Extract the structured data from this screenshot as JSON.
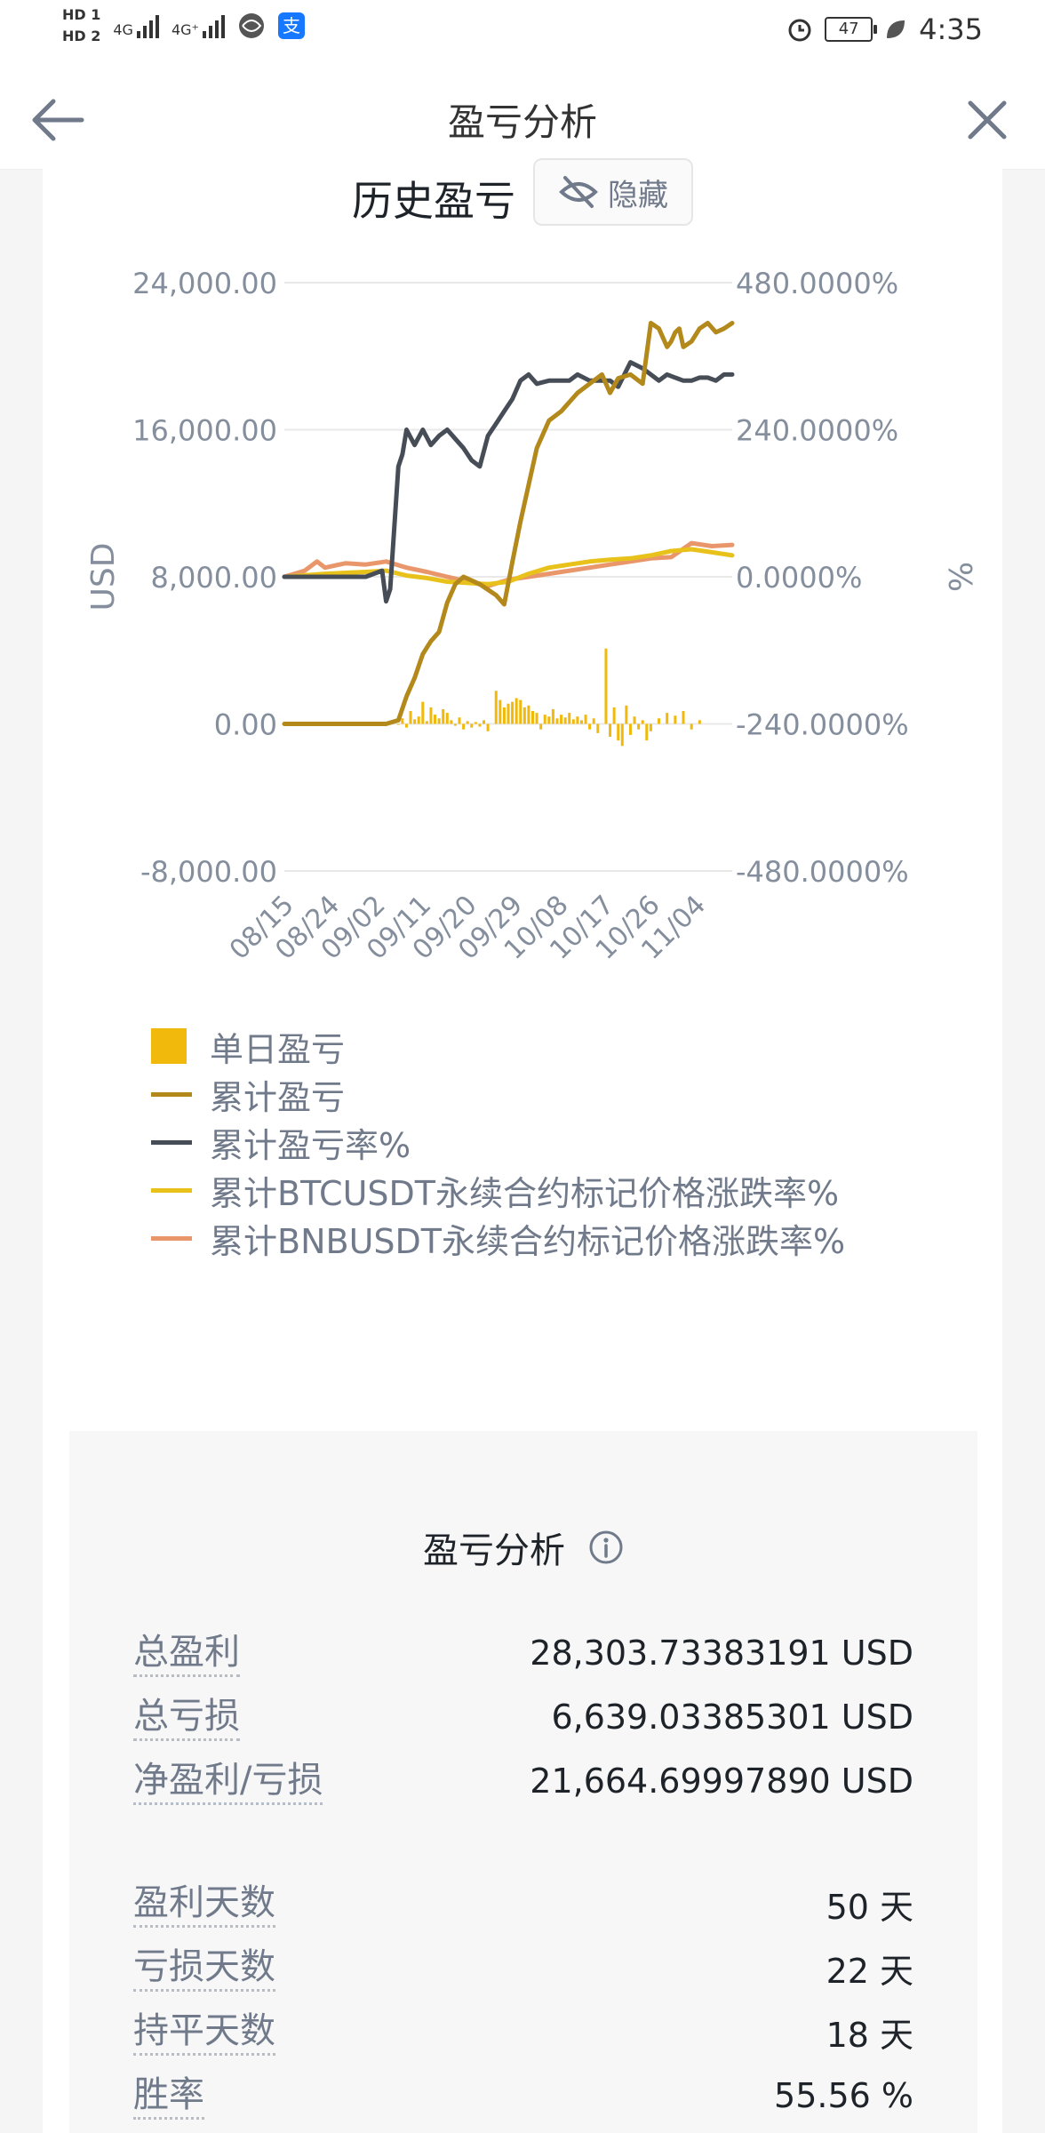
{
  "status_bar": {
    "hd1": "HD 1",
    "hd2": "HD 2",
    "sig1": "4G",
    "sig2": "4G⁺",
    "battery": "47",
    "time": "4:35"
  },
  "nav": {
    "title": "盈亏分析"
  },
  "history": {
    "title": "历史盈亏",
    "hide_label": "隐藏"
  },
  "chart_data": {
    "type": "line",
    "x_tick_labels": [
      "08/15",
      "08/24",
      "09/02",
      "09/11",
      "09/20",
      "09/29",
      "10/08",
      "10/17",
      "10/26",
      "11/04"
    ],
    "y_left": {
      "label": "USD",
      "ticks": [
        "24,000.00",
        "16,000.00",
        "8,000.00",
        "0.00",
        "-8,000.00"
      ],
      "range": [
        -8000,
        24000
      ]
    },
    "y_right": {
      "label": "%",
      "ticks": [
        "480.0000%",
        "240.0000%",
        "0.0000%",
        "-240.0000%",
        "-480.0000%"
      ],
      "range": [
        -480,
        480
      ]
    },
    "legend": [
      "单日盈亏",
      "累计盈亏",
      "累计盈亏率%",
      "累计BTCUSDT永续合约标记价格涨跌率%",
      "累计BNBUSDT永续合约标记价格涨跌率%"
    ],
    "colors": {
      "daily": "#f0b90b",
      "cum_pnl": "#b4891b",
      "cum_rate": "#474d57",
      "btc": "#e8c21a",
      "bnb": "#e9976a"
    },
    "series": [
      {
        "name": "累计盈亏",
        "axis": "left",
        "x": [
          0,
          10,
          20,
          25,
          28,
          30,
          32,
          34,
          36,
          38,
          40,
          42,
          44,
          46,
          48,
          50,
          52,
          54,
          56,
          58,
          60,
          62,
          65,
          68,
          70,
          72,
          75,
          78,
          80,
          82,
          85,
          88,
          90,
          92,
          94,
          95,
          96,
          97,
          98,
          100,
          102,
          104,
          106,
          108,
          110
        ],
        "y": [
          0,
          0,
          0,
          0,
          200,
          1500,
          2500,
          3800,
          4500,
          5000,
          6600,
          7600,
          8000,
          7800,
          7600,
          7300,
          7000,
          6500,
          8800,
          11000,
          13000,
          15000,
          16500,
          17000,
          17500,
          18000,
          18500,
          19000,
          18000,
          18800,
          19000,
          18500,
          21800,
          21500,
          20500,
          20800,
          21300,
          21500,
          20500,
          20800,
          21500,
          21800,
          21300,
          21500,
          21800
        ]
      },
      {
        "name": "累计盈亏率%",
        "axis": "right",
        "x": [
          0,
          10,
          20,
          24,
          25,
          26,
          28,
          29,
          30,
          32,
          34,
          36,
          38,
          40,
          42,
          44,
          46,
          48,
          50,
          52,
          54,
          56,
          58,
          60,
          62,
          65,
          68,
          70,
          72,
          75,
          78,
          80,
          82,
          85,
          88,
          90,
          92,
          94,
          96,
          98,
          100,
          102,
          104,
          106,
          108,
          110
        ],
        "y": [
          0,
          0,
          0,
          10,
          -40,
          -20,
          180,
          200,
          240,
          215,
          240,
          215,
          230,
          240,
          225,
          210,
          190,
          180,
          230,
          250,
          270,
          290,
          320,
          330,
          315,
          320,
          320,
          320,
          330,
          320,
          320,
          320,
          310,
          350,
          340,
          330,
          320,
          330,
          325,
          320,
          320,
          325,
          325,
          320,
          330,
          330
        ]
      },
      {
        "name": "累计BTCUSDT永续合约标记价格涨跌率%",
        "axis": "right",
        "x": [
          0,
          10,
          20,
          25,
          30,
          35,
          40,
          45,
          50,
          55,
          60,
          65,
          70,
          75,
          80,
          85,
          90,
          95,
          100,
          105,
          110
        ],
        "y": [
          0,
          5,
          8,
          10,
          2,
          -2,
          -8,
          -10,
          -12,
          -8,
          5,
          15,
          20,
          25,
          28,
          30,
          35,
          42,
          45,
          40,
          35
        ]
      },
      {
        "name": "累计BNBUSDT永续合约标记价格涨跌率%",
        "axis": "right",
        "x": [
          0,
          5,
          8,
          10,
          15,
          20,
          25,
          30,
          35,
          40,
          45,
          50,
          55,
          60,
          65,
          70,
          75,
          80,
          85,
          90,
          95,
          100,
          105,
          110
        ],
        "y": [
          0,
          10,
          25,
          15,
          22,
          20,
          25,
          15,
          8,
          0,
          -8,
          -15,
          -5,
          0,
          5,
          10,
          15,
          20,
          25,
          30,
          32,
          55,
          50,
          52
        ]
      }
    ],
    "daily_bars": [
      {
        "x": 28,
        "y": -50
      },
      {
        "x": 29,
        "y": 300
      },
      {
        "x": 30,
        "y": -200
      },
      {
        "x": 31,
        "y": 700
      },
      {
        "x": 32,
        "y": 250
      },
      {
        "x": 33,
        "y": 400
      },
      {
        "x": 34,
        "y": 1200
      },
      {
        "x": 35,
        "y": 150
      },
      {
        "x": 36,
        "y": 900
      },
      {
        "x": 37,
        "y": 500
      },
      {
        "x": 38,
        "y": 300
      },
      {
        "x": 39,
        "y": 800
      },
      {
        "x": 40,
        "y": 600
      },
      {
        "x": 41,
        "y": 200
      },
      {
        "x": 42,
        "y": -100
      },
      {
        "x": 43,
        "y": 350
      },
      {
        "x": 44,
        "y": -300
      },
      {
        "x": 45,
        "y": 150
      },
      {
        "x": 46,
        "y": -200
      },
      {
        "x": 47,
        "y": 100
      },
      {
        "x": 48,
        "y": -150
      },
      {
        "x": 49,
        "y": 200
      },
      {
        "x": 50,
        "y": -400
      },
      {
        "x": 52,
        "y": 1800
      },
      {
        "x": 53,
        "y": 1300
      },
      {
        "x": 54,
        "y": 900
      },
      {
        "x": 55,
        "y": 1100
      },
      {
        "x": 56,
        "y": 1200
      },
      {
        "x": 57,
        "y": 1400
      },
      {
        "x": 58,
        "y": 1300
      },
      {
        "x": 59,
        "y": 900
      },
      {
        "x": 60,
        "y": 1000
      },
      {
        "x": 61,
        "y": 700
      },
      {
        "x": 62,
        "y": 600
      },
      {
        "x": 63,
        "y": -300
      },
      {
        "x": 64,
        "y": 500
      },
      {
        "x": 65,
        "y": 400
      },
      {
        "x": 66,
        "y": 800
      },
      {
        "x": 67,
        "y": 300
      },
      {
        "x": 68,
        "y": 500
      },
      {
        "x": 69,
        "y": 350
      },
      {
        "x": 70,
        "y": 600
      },
      {
        "x": 71,
        "y": 250
      },
      {
        "x": 72,
        "y": 400
      },
      {
        "x": 73,
        "y": 200
      },
      {
        "x": 74,
        "y": 500
      },
      {
        "x": 75,
        "y": -300
      },
      {
        "x": 76,
        "y": 300
      },
      {
        "x": 77,
        "y": -500
      },
      {
        "x": 79,
        "y": 4100
      },
      {
        "x": 80,
        "y": -700
      },
      {
        "x": 81,
        "y": 900
      },
      {
        "x": 82,
        "y": -900
      },
      {
        "x": 83,
        "y": -1200
      },
      {
        "x": 84,
        "y": 1000
      },
      {
        "x": 85,
        "y": -600
      },
      {
        "x": 86,
        "y": 400
      },
      {
        "x": 87,
        "y": -300
      },
      {
        "x": 88,
        "y": 200
      },
      {
        "x": 89,
        "y": -900
      },
      {
        "x": 90,
        "y": -400
      },
      {
        "x": 92,
        "y": 300
      },
      {
        "x": 94,
        "y": 600
      },
      {
        "x": 96,
        "y": 450
      },
      {
        "x": 98,
        "y": 700
      },
      {
        "x": 100,
        "y": -300
      },
      {
        "x": 102,
        "y": 200
      }
    ]
  },
  "analysis": {
    "title": "盈亏分析",
    "rows": [
      {
        "label": "总盈利",
        "value": "28,303.73383191 USD"
      },
      {
        "label": "总亏损",
        "value": "6,639.03385301 USD"
      },
      {
        "label": "净盈利/亏损",
        "value": "21,664.69997890 USD"
      },
      {
        "label": "盈利天数",
        "value": "50 天"
      },
      {
        "label": "亏损天数",
        "value": "22 天"
      },
      {
        "label": "持平天数",
        "value": "18 天"
      },
      {
        "label": "胜率",
        "value": "55.56 %"
      }
    ]
  }
}
